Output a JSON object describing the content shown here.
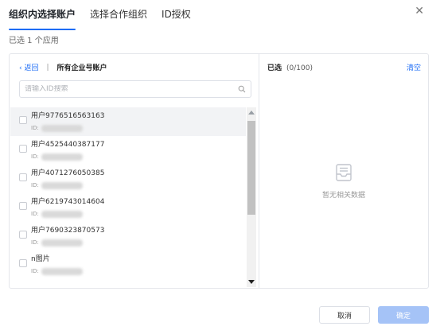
{
  "tabs": [
    "组织内选择账户",
    "选择合作组织",
    "ID授权"
  ],
  "summary": "已选 1 个应用",
  "breadcrumb": {
    "back": "‹ 返回",
    "separator": "|",
    "title": "所有企业号账户"
  },
  "search": {
    "placeholder": "请输入ID搜索"
  },
  "id_prefix": "ID:",
  "accounts": [
    {
      "name": "用户9776516563163"
    },
    {
      "name": "用户4525440387177"
    },
    {
      "name": "用户4071276050385"
    },
    {
      "name": "用户6219743014604"
    },
    {
      "name": "用户7690323870573"
    },
    {
      "name": "n图片"
    }
  ],
  "selected": {
    "title": "已选",
    "count": "(0/100)",
    "clear": "清空",
    "empty": "暂无相关数据"
  },
  "footer": {
    "cancel": "取消",
    "confirm": "确定"
  },
  "icons": {
    "close": "close-icon",
    "search": "search-icon",
    "empty": "inbox-icon"
  },
  "colors": {
    "accent": "#1d6cf5",
    "confirm_disabled": "#a5c3f7"
  }
}
